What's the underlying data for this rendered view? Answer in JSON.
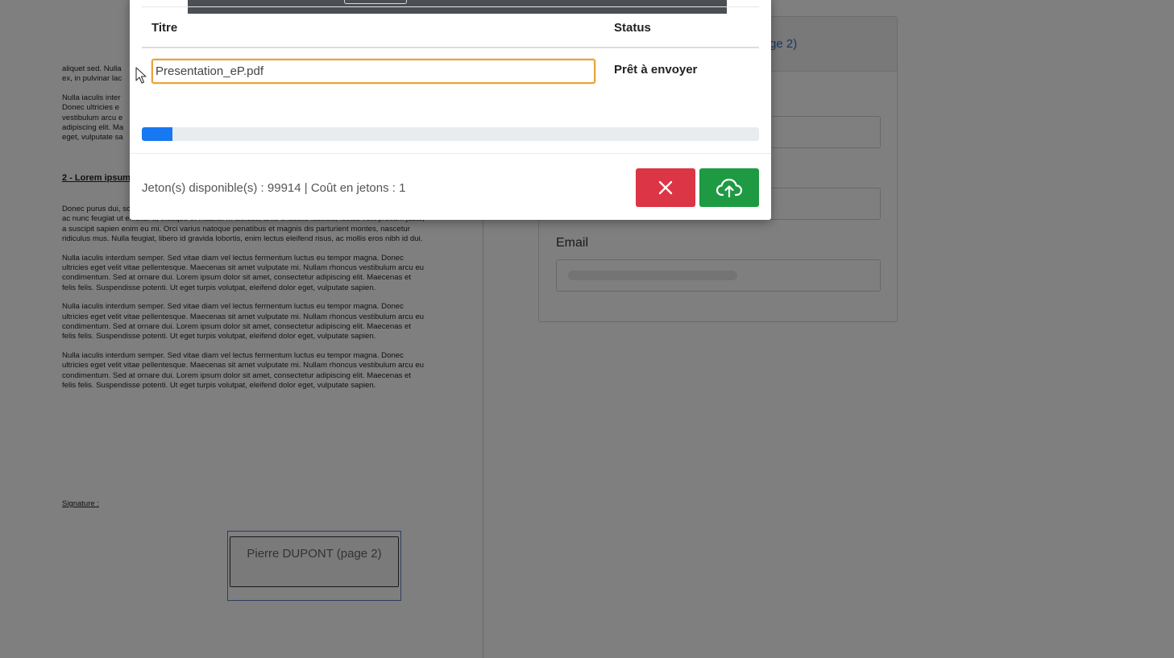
{
  "background": {
    "document": {
      "top_lines": [
        "aliquet sed. Nulla",
        "ex, in pulvinar lac"
      ],
      "para_top": "Nulla iaculis inter Donec ultricies e vestibulum arcu e adipiscing elit. Ma eget, vulputate sa",
      "heading": "2 - Lorem ipsum",
      "paragraphs": [
        "Donec purus dui, sodales. Etiam massa turpis, lobortis eget nunc molestie, varius vestibulum orci. Morbi ac nunc feugiat ut efficitur a, tristique et mauris. In ultrices, ante a iaculis facilisis, lectus velit pretium justo, a suscipit sapien enim eu mi. Orci varius natoque penatibus et magnis dis parturient montes, nascetur ridiculus mus. Nulla feugiat, libero id gravida lobortis, enim lectus eleifend risus, ac mollis eros nibh id dui.",
        "Nulla iaculis interdum semper. Sed vitae diam vel lectus fermentum luctus eu tempor magna. Donec ultricies eget velit vitae pellentesque. Maecenas sit amet vulputate mi. Nullam rhoncus vestibulum arcu eu condimentum. Sed at ornare dui. Lorem ipsum dolor sit amet, consectetur adipiscing elit. Maecenas et felis felis. Suspendisse potenti. Ut eget turpis volutpat, eleifend dolor eget, vulputate sapien.",
        "Nulla iaculis interdum semper. Sed vitae diam vel lectus fermentum luctus eu tempor magna. Donec ultricies eget velit vitae pellentesque. Maecenas sit amet vulputate mi. Nullam rhoncus vestibulum arcu eu condimentum. Sed at ornare dui. Lorem ipsum dolor sit amet, consectetur adipiscing elit. Maecenas et felis felis. Suspendisse potenti. Ut eget turpis volutpat, eleifend dolor eget, vulputate sapien.",
        "Nulla iaculis interdum semper. Sed vitae diam vel lectus fermentum luctus eu tempor magna. Donec ultricies eget velit vitae pellentesque. Maecenas sit amet vulputate mi. Nullam rhoncus vestibulum arcu eu condimentum. Sed at ornare dui. Lorem ipsum dolor sit amet, consectetur adipiscing elit. Maecenas et felis felis. Suspendisse potenti. Ut eget turpis volutpat, eleifend dolor eget, vulputate sapien."
      ],
      "signature_label": "Signature :",
      "signature_box": "Pierre DUPONT (page 2)"
    },
    "right_panel": {
      "link_fragment": "ge 2)",
      "email_label": "Email"
    }
  },
  "modal": {
    "columns": {
      "title": "Titre",
      "status": "Status"
    },
    "row": {
      "filename": "Presentation_eP.pdf",
      "status": "Prêt à envoyer"
    },
    "progress_percent": 5,
    "token_info": "Jeton(s) disponible(s) : 99914 | Coût en jetons : 1",
    "colors": {
      "cancel": "#dc3545",
      "upload": "#1e9a43",
      "progress": "#1778f2",
      "input_focus": "#e8a33a"
    },
    "icons": {
      "cancel": "close-icon",
      "upload": "cloud-upload-icon"
    }
  }
}
